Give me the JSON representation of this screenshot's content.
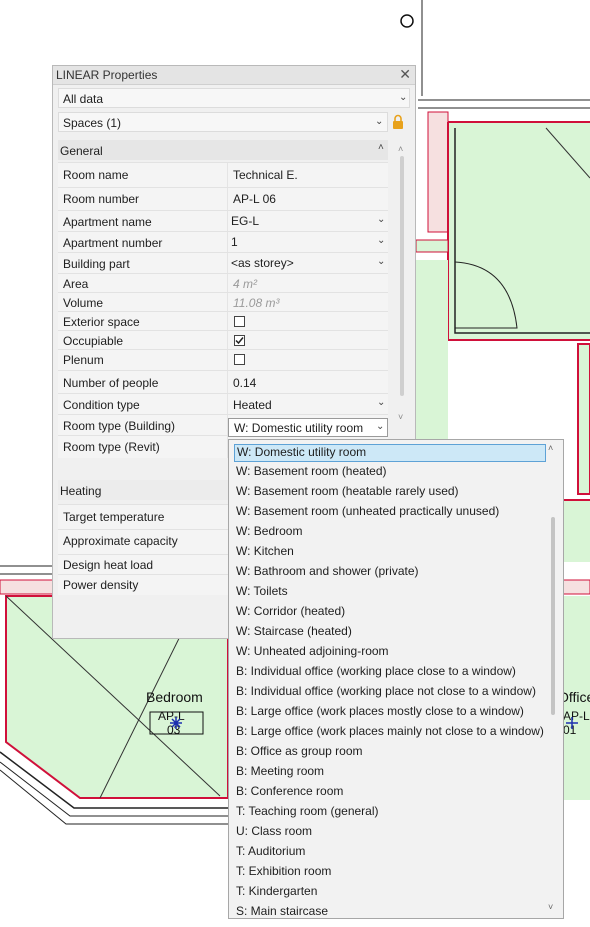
{
  "window": {
    "title": "LINEAR Properties",
    "close_glyph": "✕"
  },
  "filter_data": {
    "value": "All data"
  },
  "filter_spaces": {
    "value": "Spaces (1)"
  },
  "sections": {
    "general": "General",
    "heating": "Heating"
  },
  "properties": [
    {
      "label": "Room name",
      "value": "Technical E."
    },
    {
      "label": "Room number",
      "value": "AP-L 06"
    },
    {
      "label": "Apartment name",
      "value": "EG-L"
    },
    {
      "label": "Apartment number",
      "value": "1"
    },
    {
      "label": "Building part",
      "value": "<as storey>"
    },
    {
      "label": "Area",
      "value": "4 m²"
    },
    {
      "label": "Volume",
      "value": "11.08 m³"
    },
    {
      "label": "Exterior space",
      "value": ""
    },
    {
      "label": "Occupiable",
      "value": ""
    },
    {
      "label": "Plenum",
      "value": ""
    },
    {
      "label": "Number of people",
      "value": "0.14"
    },
    {
      "label": "Condition type",
      "value": "Heated"
    },
    {
      "label": "Room type (Building)",
      "value": "W: Domestic utility room"
    },
    {
      "label": "Room type (Revit)",
      "value": ""
    }
  ],
  "heating_properties": [
    {
      "label": "Target temperature"
    },
    {
      "label": "Approximate capacity"
    },
    {
      "label": "Design heat load"
    },
    {
      "label": "Power density"
    }
  ],
  "checkboxes": {
    "exterior_space": false,
    "occupiable": true,
    "plenum": false
  },
  "dropdown": {
    "selected": "W: Domestic utility room",
    "options": [
      "W: Domestic utility room",
      "W: Basement room (heated)",
      "W: Basement room (heatable rarely used)",
      "W: Basement room (unheated practically unused)",
      "W: Bedroom",
      "W: Kitchen",
      "W: Bathroom and shower (private)",
      "W: Toilets",
      "W: Corridor (heated)",
      "W: Staircase (heated)",
      "W: Unheated adjoining-room",
      "B: Individual office (working place close to a window)",
      "B: Individual office (working place not close to a window)",
      "B: Large office (work places mostly close to a window)",
      "B: Large office (work places mainly not close to a window)",
      "B: Office as group room",
      "B: Meeting room",
      "B: Conference room",
      "T: Teaching room (general)",
      "U: Class room",
      "T: Auditorium",
      "T: Exhibition room",
      "T: Kindergarten",
      "S: Main staircase"
    ]
  },
  "drawing": {
    "room_left_name": "Bedroom",
    "room_left_tag_top": "AP-L",
    "room_left_tag_bottom": "03",
    "room_right_name": "Office",
    "room_right_tag_top": "AP-L",
    "room_right_tag_bottom": "01",
    "fill_color": "#d9f5d6",
    "boundary_color": "#d0103a"
  },
  "colors": {
    "selection_bg": "#cde8f7",
    "selection_border": "#5ea2d6",
    "lock": "#e8a21c"
  }
}
